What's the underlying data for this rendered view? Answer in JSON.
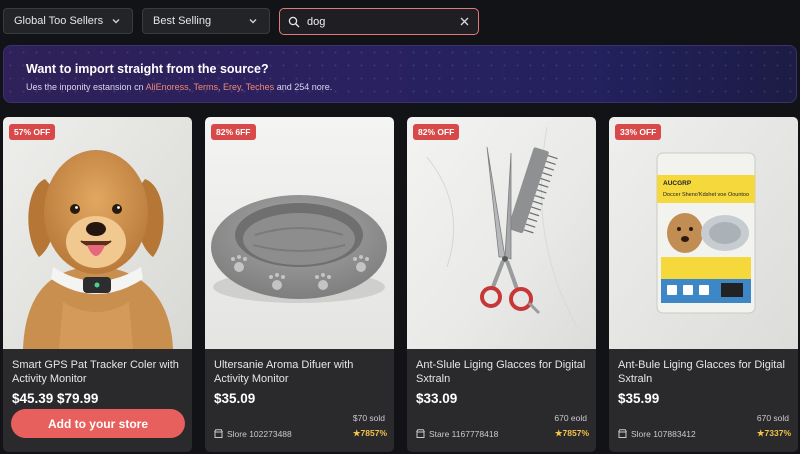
{
  "filters": {
    "region": "Global Too Sellers",
    "sort": "Best Selling"
  },
  "search": {
    "value": "dog"
  },
  "banner": {
    "title": "Want to import straight from the source?",
    "sub_prefix": "Ues the inponity estansion cn ",
    "links": [
      "AliEnoress,",
      "Terms,",
      "Erey,",
      "Teches"
    ],
    "sub_suffix": " and 254 nore."
  },
  "products": [
    {
      "badge": "57% OFF",
      "title": "Smart GPS Pat Tracker Coler with Activity Monitor",
      "price": "$45.39 $79.99",
      "button": "Add to your store",
      "image_icon": "golden-retriever-photo"
    },
    {
      "badge": "82% 6FF",
      "title": "Ultersanie Aroma Difuer with Activity Monitor",
      "price": "$35.09",
      "sold": "$70 sold",
      "store": "Slore 102273488",
      "rating": "7857%",
      "image_icon": "round-pet-bed-photo"
    },
    {
      "badge": "82% OFF",
      "title": "Ant-Slule Liging Glacces for Digital Sxtraln",
      "price": "$33.09",
      "sold": "670 eold",
      "store": "Stare 1167778418",
      "rating": "7857%",
      "image_icon": "grooming-scissors-comb-photo"
    },
    {
      "badge": "33% OFF",
      "title": "Ant-Bule Liging Glacces for Digital Sxtraln",
      "price": "$35.99",
      "sold": "670 sold",
      "store": "Slore 107883412",
      "rating": "7337%",
      "image_icon": "dog-treat-package-photo",
      "package_brand": "AUCGRP",
      "package_headline": "Doccer Sheno'Kdshet voe Oountoo"
    }
  ],
  "colors": {
    "background": "#121316",
    "card": "#2a2a2d",
    "badge": "#d84a4a",
    "button": "#e7605e",
    "rating": "#f3c24a",
    "link_highlight": "#f08a74",
    "search_border": "#e27a7a"
  }
}
